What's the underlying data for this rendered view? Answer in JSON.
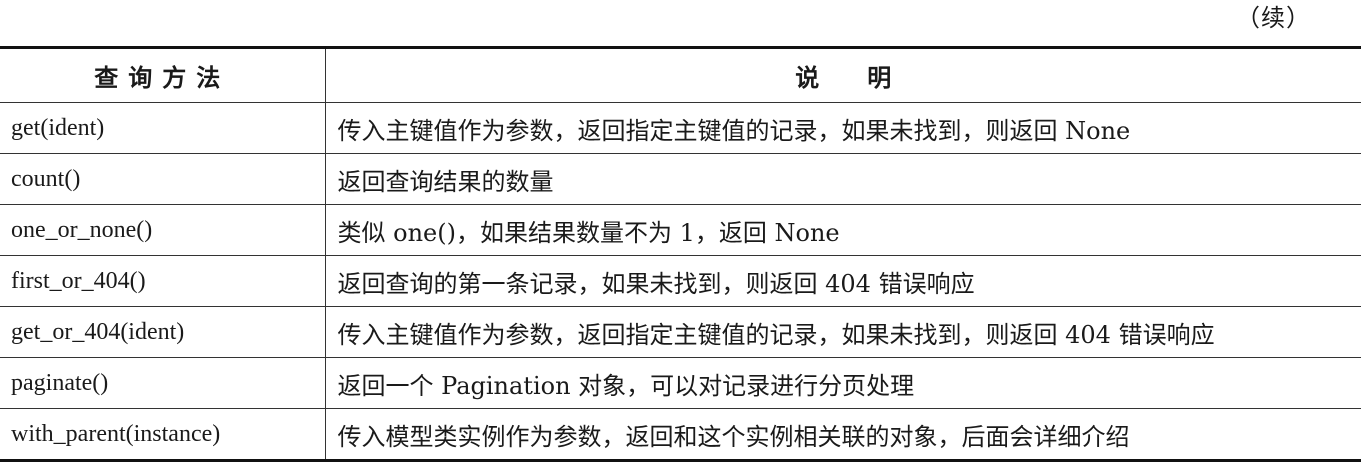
{
  "continued_label": "（续）",
  "table": {
    "headers": {
      "method": "查询方法",
      "description": "说明"
    },
    "rows": [
      {
        "method": "get(ident)",
        "description": "传入主键值作为参数，返回指定主键值的记录，如果未找到，则返回 None"
      },
      {
        "method": "count()",
        "description": "返回查询结果的数量"
      },
      {
        "method": "one_or_none()",
        "description": "类似 one()，如果结果数量不为 1，返回 None"
      },
      {
        "method": "first_or_404()",
        "description": "返回查询的第一条记录，如果未找到，则返回 404 错误响应"
      },
      {
        "method": "get_or_404(ident)",
        "description": "传入主键值作为参数，返回指定主键值的记录，如果未找到，则返回 404 错误响应"
      },
      {
        "method": "paginate()",
        "description": "返回一个 Pagination 对象，可以对记录进行分页处理"
      },
      {
        "method": "with_parent(instance)",
        "description": "传入模型类实例作为参数，返回和这个实例相关联的对象，后面会详细介绍"
      }
    ]
  }
}
